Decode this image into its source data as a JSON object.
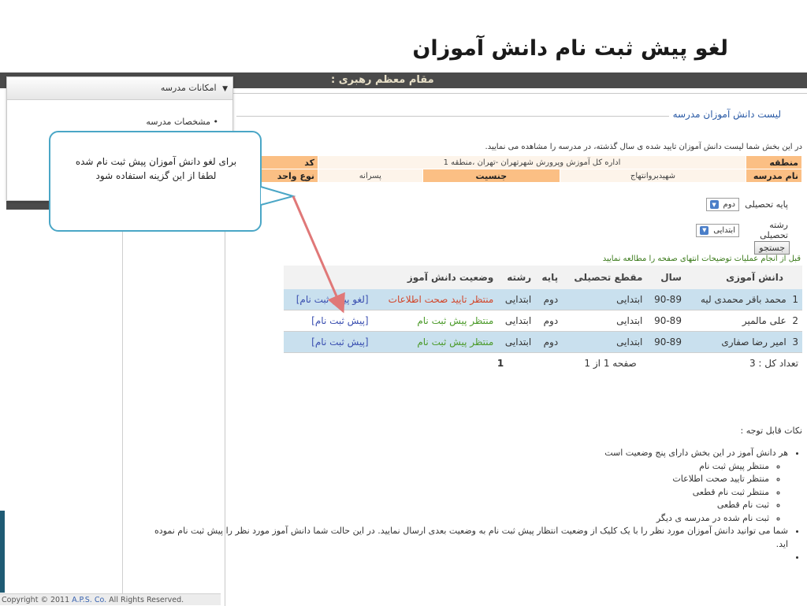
{
  "slide_title": "لغو پیش ثبت نام دانش آموزان",
  "topbar_text": "مقام معظم رهبری :",
  "menu": {
    "header": "امکانات مدرسه",
    "item": "مشخصات مدرسه"
  },
  "callout": {
    "line1": "برای لغو دانش آموزان پیش ثبت نام شده",
    "line2": "لطفا از این گزینه استفاده شود"
  },
  "section_title": "لیست دانش آموزان مدرسه",
  "intro": "در این بخش شما لیست دانش آموزان تایید شده ی سال گذشته، در مدرسه را مشاهده می نمایید.",
  "info": {
    "region_label": "منطقه",
    "region_value": "اداره کل آموزش وپرورش شهرتهران -تهران ،منطقه 1",
    "code_label": "کد",
    "code_value": "",
    "school_label": "نام مدرسه",
    "school_value": "شهیدبروانتهاج",
    "gender_label": "جنسیت",
    "gender_value": "پسرانه",
    "unit_label": "نوع واحد",
    "unit_value": ""
  },
  "form": {
    "grade_label": "پایه تحصیلی",
    "grade_value": "دوم",
    "field_label": "رشته تحصیلی",
    "field_value": "ابتدایی",
    "search_button": "جستجو",
    "note": "قبل از انجام عملیات توضیحات انتهای صفحه را مطالعه نمایید"
  },
  "students": {
    "headers": [
      "دانش آموزی",
      "سال",
      "مقطع تحصیلی",
      "پایه",
      "رشته",
      "وضعیت دانش آموز",
      ""
    ],
    "rows": [
      {
        "num": "1",
        "name": "محمد باقر محمدی لیه",
        "year": "90-89",
        "level": "ابتدایی",
        "grade": "دوم",
        "field": "ابتدایی",
        "status": "منتظر تایید صحت اطلاعات",
        "action": "[لغو پیش ثبت نام]"
      },
      {
        "num": "2",
        "name": "علی مالمیر",
        "year": "90-89",
        "level": "ابتدایی",
        "grade": "دوم",
        "field": "ابتدایی",
        "status": "منتظر پیش ثبت نام",
        "action": "[پیش ثبت نام]"
      },
      {
        "num": "3",
        "name": "امیر رضا صفاری",
        "year": "90-89",
        "level": "ابتدایی",
        "grade": "دوم",
        "field": "ابتدایی",
        "status": "منتظر پیش ثبت نام",
        "action": "[پیش ثبت نام]"
      }
    ],
    "total": "تعداد کل : 3",
    "page_info": "صفحه 1 از 1",
    "page_num": "1"
  },
  "notes": {
    "title": "نکات قابل توجه :",
    "item1": "هر دانش آموز در این بخش دارای پنج وضعیت است",
    "sub": [
      "منتظر پیش ثبت نام",
      "منتظر تایید صحت اطلاعات",
      "منتظر ثبت نام قطعی",
      "ثبت نام قطعی",
      "ثبت نام شده در مدرسه ی دیگر"
    ],
    "item2": "شما می توانید دانش آموزان مورد نظر را با یک کلیک از وضعیت انتظار پیش ثبت نام به وضعیت بعدی ارسال نمایید. در این حالت شما دانش آموز مورد نظر را پیش ثبت نام نموده اید."
  },
  "copyright": {
    "prefix": "Copyright © 2011 ",
    "company": "A.P.S. Co.",
    "suffix": " All Rights Reserved."
  },
  "colors": {
    "header_bar": "#4a4a4a",
    "label_orange": "#fbbf84",
    "row_blue": "#c9e0ee",
    "callout_border": "#4aa6c6",
    "arrow": "#e07878"
  }
}
